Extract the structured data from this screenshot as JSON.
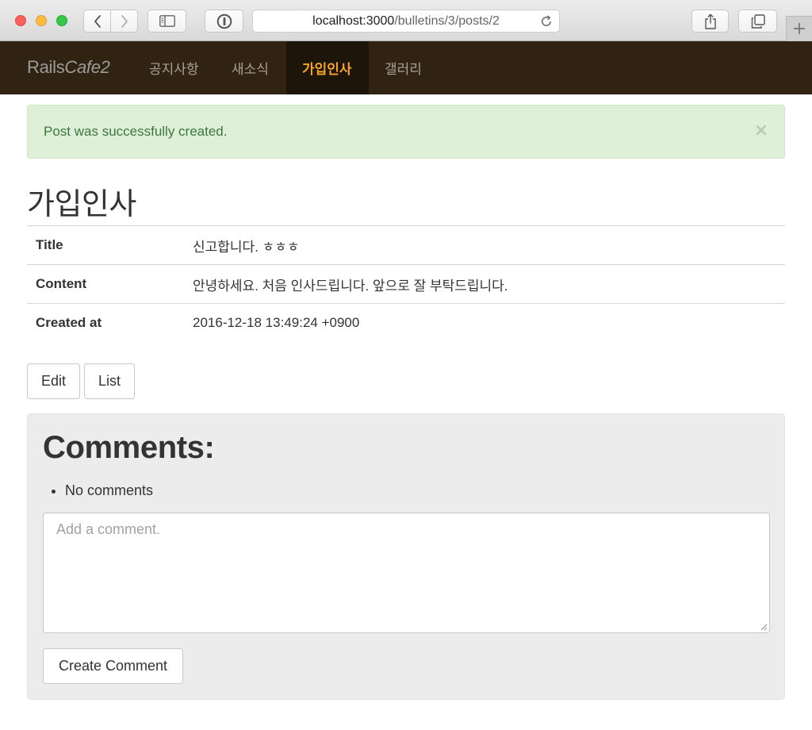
{
  "browser": {
    "url_host": "localhost:3000",
    "url_path": "/bulletins/3/posts/2",
    "new_tab_label": "+"
  },
  "navbar": {
    "brand_plain": "Rails",
    "brand_italic": "Cafe2",
    "items": [
      {
        "label": "공지사항",
        "active": false
      },
      {
        "label": "새소식",
        "active": false
      },
      {
        "label": "가입인사",
        "active": true
      },
      {
        "label": "갤러리",
        "active": false
      }
    ],
    "active_color": "#f6a623",
    "background": "#312312"
  },
  "alert": {
    "message": "Post was successfully created.",
    "close_glyph": "×"
  },
  "page": {
    "title": "가입인사"
  },
  "post": {
    "rows": [
      {
        "label": "Title",
        "value": "신고합니다. ㅎㅎㅎ"
      },
      {
        "label": "Content",
        "value": "안녕하세요. 처음 인사드립니다. 앞으로 잘 부탁드립니다."
      },
      {
        "label": "Created at",
        "value": "2016-12-18 13:49:24 +0900"
      }
    ]
  },
  "actions": {
    "edit_label": "Edit",
    "list_label": "List"
  },
  "comments": {
    "heading": "Comments:",
    "empty_text": "No comments",
    "placeholder": "Add a comment.",
    "submit_label": "Create Comment"
  },
  "icons": [
    "chevron-left-icon",
    "chevron-right-icon",
    "sidebar-icon",
    "privacy-icon",
    "reload-icon",
    "share-icon",
    "tabs-icon",
    "close-icon",
    "resize-grip-icon"
  ]
}
